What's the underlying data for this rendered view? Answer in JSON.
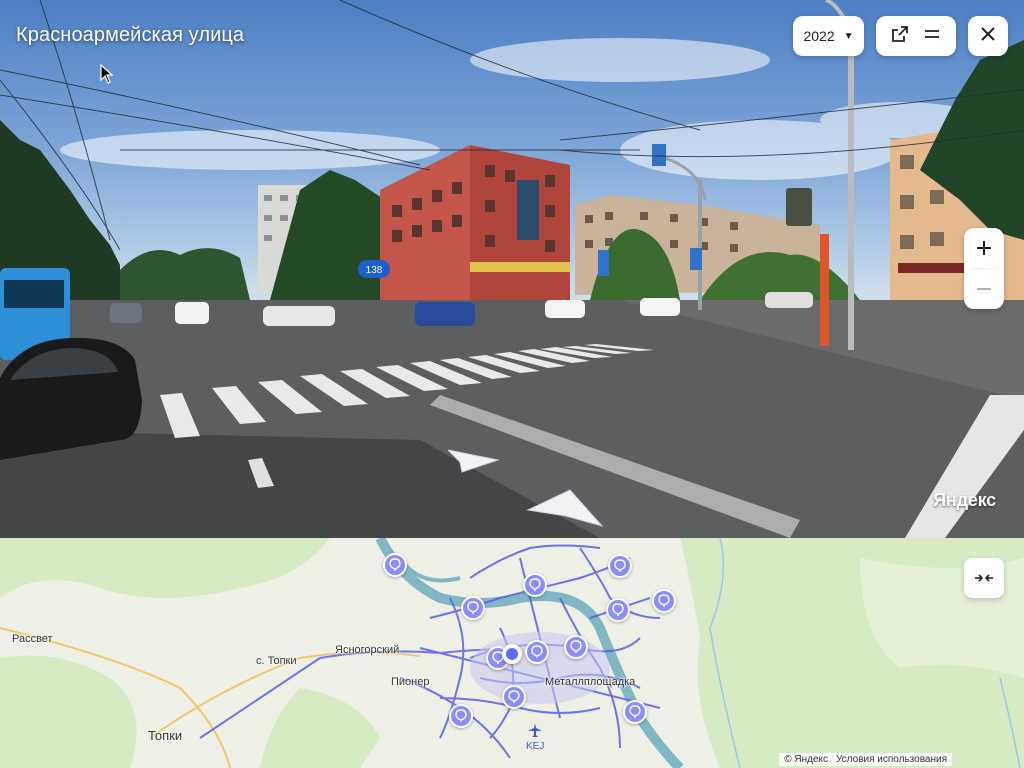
{
  "panorama": {
    "street_name": "Красноармейская улица",
    "year": "2022",
    "bus_route_label": "138",
    "watermark": "Яндекс",
    "icons": {
      "year_dropdown": "caret-down-icon",
      "open_external": "external-link-icon",
      "menu": "hamburger-menu-icon",
      "close": "close-icon",
      "zoom_in": "plus-icon",
      "zoom_out": "minus-icon",
      "nav_forward": "nav-arrow-forward-icon",
      "nav_back": "nav-arrow-back-icon"
    }
  },
  "map": {
    "places": {
      "rassvet": "Рассвет",
      "s_topki": "с. Топки",
      "yasnogorsky": "Ясногорский",
      "pioner": "Пионер",
      "metallploshchadka": "Металлплощадка",
      "topki": "Топки"
    },
    "airport_code": "KEJ",
    "attribution": "© Яндекс",
    "terms": "Условия использования",
    "icons": {
      "collapse": "collapse-arrows-icon",
      "panorama_pin": "balloon-pin-icon",
      "airport": "airplane-icon",
      "current_position": "current-position-marker"
    },
    "colors": {
      "pin": "#8b8dfb",
      "roads_network": "#5b5ee8",
      "river": "#7fb8c4",
      "forest": "#d6ebc3"
    }
  }
}
